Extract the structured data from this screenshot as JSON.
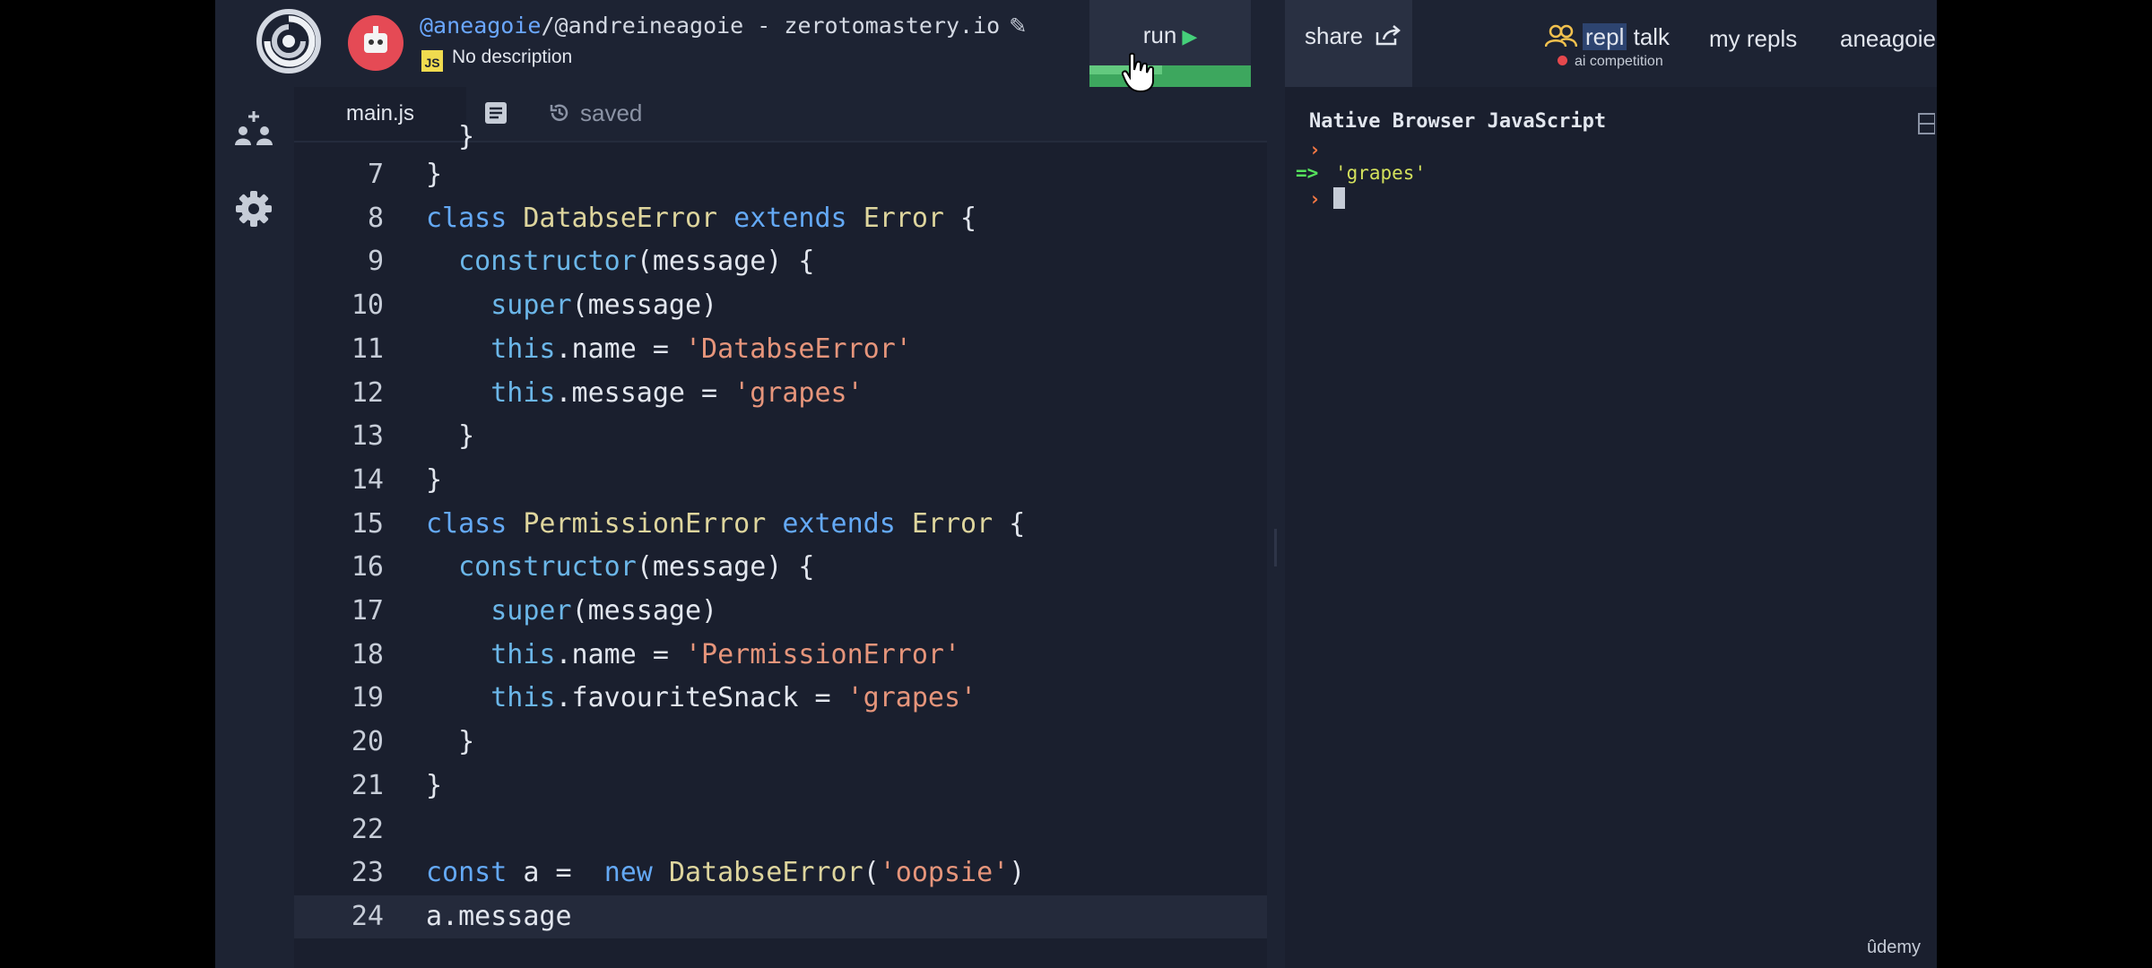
{
  "topbar": {
    "owner": "@aneagoie",
    "repl_name": "/@andreineagoie - zerotomastery.io",
    "js_badge": "JS",
    "description": "No description",
    "run_label": "run",
    "run_progress": 0.45,
    "share_label": "share",
    "repl_label": "repl",
    "talk_label": "talk",
    "talk_sub": "ai competition",
    "my_repls_label": "my repls",
    "username": "aneagoie"
  },
  "editor": {
    "tab_label": "main.js",
    "saved_label": "saved",
    "lines": [
      {
        "n": "7",
        "tokens": [
          {
            "t": "}",
            "c": "text"
          }
        ]
      },
      {
        "n": "8",
        "tokens": [
          {
            "t": "class ",
            "c": "kw"
          },
          {
            "t": "DatabseError",
            "c": "cls"
          },
          {
            "t": " extends ",
            "c": "kw"
          },
          {
            "t": "Error",
            "c": "cls"
          },
          {
            "t": " {",
            "c": "text"
          }
        ]
      },
      {
        "n": "9",
        "tokens": [
          {
            "t": "  ",
            "c": "text"
          },
          {
            "t": "constructor",
            "c": "fn"
          },
          {
            "t": "(message) {",
            "c": "text"
          }
        ]
      },
      {
        "n": "10",
        "tokens": [
          {
            "t": "    ",
            "c": "text"
          },
          {
            "t": "super",
            "c": "fn"
          },
          {
            "t": "(message)",
            "c": "text"
          }
        ]
      },
      {
        "n": "11",
        "tokens": [
          {
            "t": "    ",
            "c": "text"
          },
          {
            "t": "this",
            "c": "fn"
          },
          {
            "t": ".name = ",
            "c": "text"
          },
          {
            "t": "'DatabseError'",
            "c": "str"
          }
        ]
      },
      {
        "n": "12",
        "tokens": [
          {
            "t": "    ",
            "c": "text"
          },
          {
            "t": "this",
            "c": "fn"
          },
          {
            "t": ".message = ",
            "c": "text"
          },
          {
            "t": "'grapes'",
            "c": "str"
          }
        ]
      },
      {
        "n": "13",
        "tokens": [
          {
            "t": "  }",
            "c": "text"
          }
        ]
      },
      {
        "n": "14",
        "tokens": [
          {
            "t": "}",
            "c": "text"
          }
        ]
      },
      {
        "n": "15",
        "tokens": [
          {
            "t": "class ",
            "c": "kw"
          },
          {
            "t": "PermissionError",
            "c": "cls"
          },
          {
            "t": " extends ",
            "c": "kw"
          },
          {
            "t": "Error",
            "c": "cls"
          },
          {
            "t": " {",
            "c": "text"
          }
        ]
      },
      {
        "n": "16",
        "tokens": [
          {
            "t": "  ",
            "c": "text"
          },
          {
            "t": "constructor",
            "c": "fn"
          },
          {
            "t": "(message) {",
            "c": "text"
          }
        ]
      },
      {
        "n": "17",
        "tokens": [
          {
            "t": "    ",
            "c": "text"
          },
          {
            "t": "super",
            "c": "fn"
          },
          {
            "t": "(message)",
            "c": "text"
          }
        ]
      },
      {
        "n": "18",
        "tokens": [
          {
            "t": "    ",
            "c": "text"
          },
          {
            "t": "this",
            "c": "fn"
          },
          {
            "t": ".name = ",
            "c": "text"
          },
          {
            "t": "'PermissionError'",
            "c": "str"
          }
        ]
      },
      {
        "n": "19",
        "tokens": [
          {
            "t": "    ",
            "c": "text"
          },
          {
            "t": "this",
            "c": "fn"
          },
          {
            "t": ".favouriteSnack = ",
            "c": "text"
          },
          {
            "t": "'grapes'",
            "c": "str"
          }
        ]
      },
      {
        "n": "20",
        "tokens": [
          {
            "t": "  }",
            "c": "text"
          }
        ]
      },
      {
        "n": "21",
        "tokens": [
          {
            "t": "}",
            "c": "text"
          }
        ]
      },
      {
        "n": "22",
        "tokens": []
      },
      {
        "n": "23",
        "tokens": [
          {
            "t": "const",
            "c": "kw"
          },
          {
            "t": " a =  ",
            "c": "text"
          },
          {
            "t": "new",
            "c": "kw"
          },
          {
            "t": " ",
            "c": "text"
          },
          {
            "t": "DatabseError",
            "c": "cls"
          },
          {
            "t": "(",
            "c": "text"
          },
          {
            "t": "'oopsie'",
            "c": "str"
          },
          {
            "t": ")",
            "c": "text"
          }
        ]
      },
      {
        "n": "24",
        "tokens": [
          {
            "t": "a.message",
            "c": "text"
          }
        ],
        "active": true
      }
    ]
  },
  "console": {
    "title": "Native Browser JavaScript",
    "prompt_glyph": "›",
    "arrow": "=>",
    "result": "'grapes'"
  },
  "watermark": "ûdemy",
  "colors": {
    "background": "#1d2333",
    "editor_bg": "#1a1f2e",
    "run_green": "#3da75e",
    "avatar": "#e54a55",
    "keyword": "#64a9f5",
    "string": "#e6957b"
  },
  "icons": {
    "logo": "replit-spiral-logo-icon",
    "avatar": "robot-avatar-icon",
    "edit": "pencil-icon",
    "run": "play-icon",
    "share": "share-arrow-icon",
    "talk": "people-icon",
    "multiplayer": "add-people-icon",
    "settings": "gear-icon",
    "doc": "document-icon",
    "saved": "history-icon",
    "expand": "expand-icon"
  }
}
